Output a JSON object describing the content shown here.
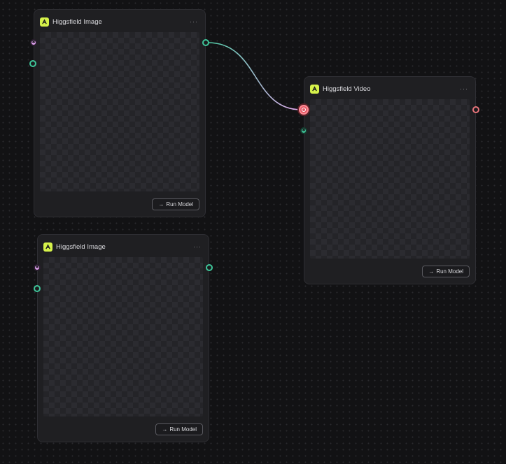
{
  "nodes": [
    {
      "title": "Higgsfield Image",
      "menu": "···",
      "run_label": "Run Model",
      "run_icon": "→"
    },
    {
      "title": "Higgsfield Video",
      "menu": "···",
      "run_label": "Run Model",
      "run_icon": "→"
    },
    {
      "title": "Higgsfield Image",
      "menu": "···",
      "run_label": "Run Model",
      "run_icon": "→"
    }
  ],
  "colors": {
    "canvas": "#121214",
    "node": "#1f1f22",
    "logo": "#d6f24a",
    "port_green": "#3fc69a",
    "port_pink": "#e3a4f2",
    "port_red": "#e8747a"
  },
  "icons": [
    "higgsfield-logo-icon",
    "more-options-icon",
    "arrow-right-icon"
  ]
}
